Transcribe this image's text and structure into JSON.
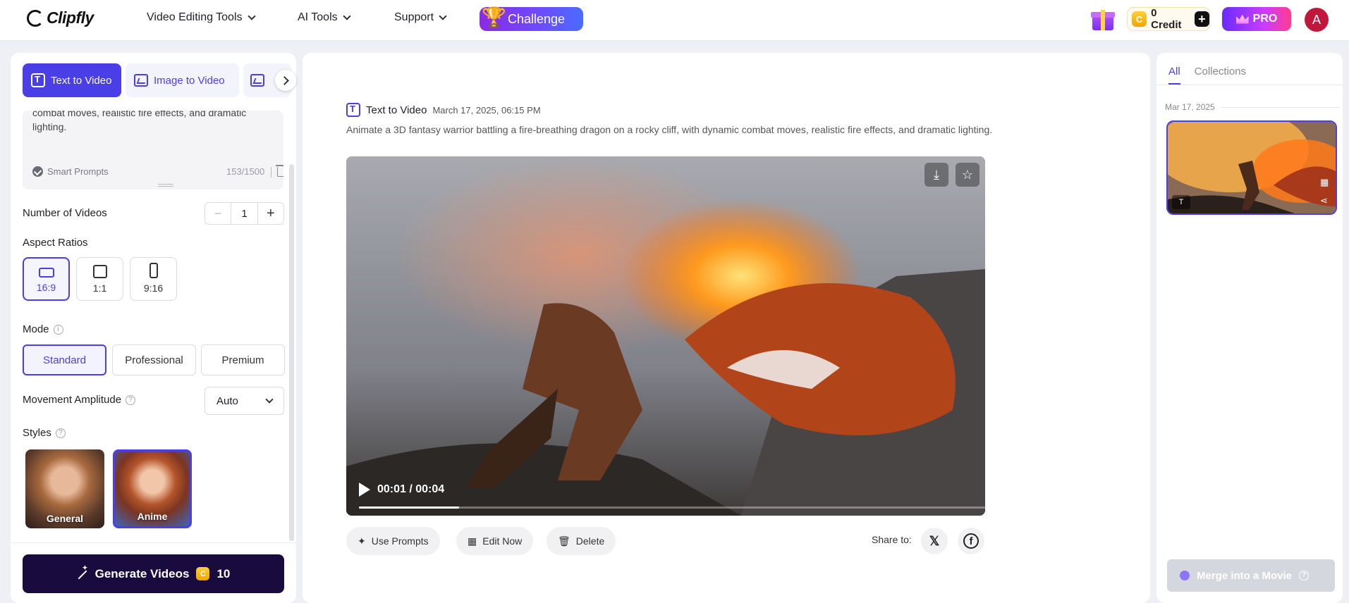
{
  "header": {
    "logo": "Clipfly",
    "nav": [
      "Video Editing Tools",
      "AI Tools",
      "Support"
    ],
    "challenge": "Challenge",
    "credit_coin": "C",
    "credit": "0 Credit",
    "pro": "PRO",
    "avatar": "A"
  },
  "left": {
    "tabs": [
      "Text to Video",
      "Image to Video"
    ],
    "prompt_text": "combat moves, realistic fire effects, and dramatic lighting.",
    "smart_prompts": "Smart Prompts",
    "char_count": "153/1500",
    "num_videos_label": "Number of Videos",
    "num_videos": "1",
    "minus": "−",
    "plus": "+",
    "aspect_label": "Aspect Ratios",
    "aspects": [
      "16:9",
      "1:1",
      "9:16"
    ],
    "mode_label": "Mode",
    "modes": [
      "Standard",
      "Professional",
      "Premium"
    ],
    "movement_label": "Movement Amplitude",
    "movement_value": "Auto",
    "styles_label": "Styles",
    "styles": [
      "General",
      "Anime"
    ],
    "generate_label": "Generate Videos",
    "generate_cost": "10",
    "info_mark": "i",
    "help_mark": "?"
  },
  "center": {
    "record_title": "Text to Video",
    "record_date": "March 17, 2025, 06:15 PM",
    "prompt": "Animate a 3D fantasy warrior battling a fire-breathing dragon on a rocky cliff, with dynamic combat moves, realistic fire effects, and dramatic lighting.",
    "time": "00:01 / 00:04",
    "progress": 0.16,
    "actions": [
      "Use Prompts",
      "Edit Now",
      "Delete"
    ],
    "share_label": "Share to:",
    "social": [
      "x-icon",
      "facebook-icon"
    ]
  },
  "right": {
    "tabs": [
      "All",
      "Collections"
    ],
    "date": "Mar 17, 2025",
    "merge_label": "Merge into a Movie"
  },
  "colors": {
    "accent": "#4a3ee6",
    "generate": "#1a0b3e"
  }
}
